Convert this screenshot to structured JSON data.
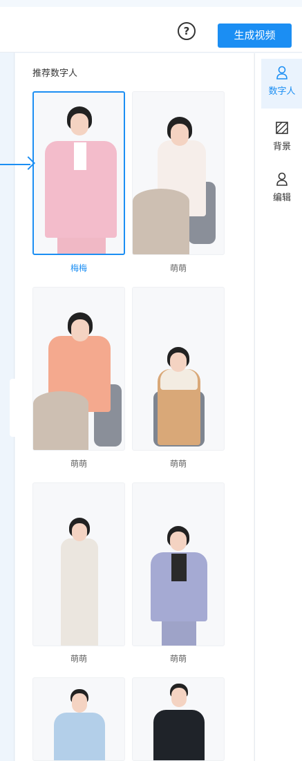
{
  "header": {
    "help_icon": "question-circle-icon",
    "generate_label": "生成视频"
  },
  "panel": {
    "section_title": "推荐数字人",
    "avatars": [
      {
        "name": "梅梅",
        "selected": true
      },
      {
        "name": "萌萌",
        "selected": false
      },
      {
        "name": "萌萌",
        "selected": false
      },
      {
        "name": "萌萌",
        "selected": false
      },
      {
        "name": "萌萌",
        "selected": false
      },
      {
        "name": "萌萌",
        "selected": false
      }
    ]
  },
  "tabs": [
    {
      "label": "数字人",
      "icon": "person-icon",
      "active": true
    },
    {
      "label": "背景",
      "icon": "background-icon",
      "active": false
    },
    {
      "label": "编辑",
      "icon": "edit-person-icon",
      "active": false
    }
  ],
  "colors": {
    "accent": "#1b8ef3",
    "panel_bg": "#ffffff",
    "page_bg": "#f3f8fd"
  }
}
